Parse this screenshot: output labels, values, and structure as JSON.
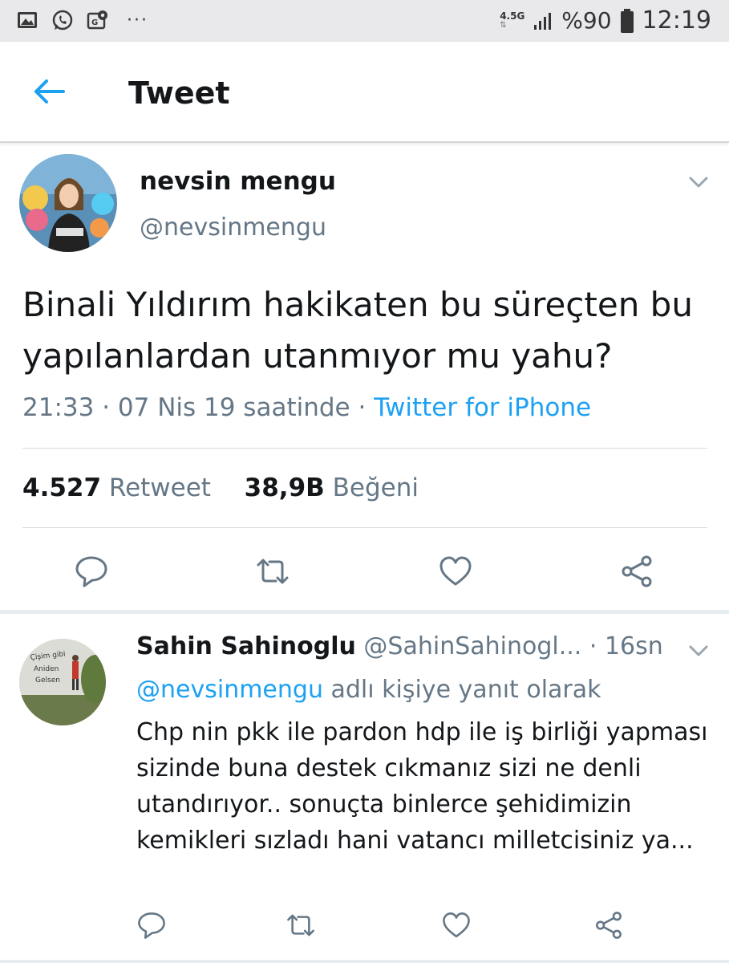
{
  "status_bar": {
    "network": "4.5G",
    "battery": "%90",
    "time": "12:19",
    "left_icons": [
      "image-icon",
      "whatsapp-icon",
      "gallery-map-icon"
    ],
    "more": "···"
  },
  "header": {
    "title": "Tweet",
    "accent": "#1da1f2"
  },
  "tweet": {
    "author_name": "nevsin mengu",
    "author_handle": "@nevsinmengu",
    "text": "Binali Yıldırım hakikaten bu süreçten bu yapılanlardan utanmıyor mu yahu?",
    "timestamp": "21:33 · 07 Nis 19 saatinde · ",
    "source": "Twitter for iPhone",
    "retweet_count": "4.527",
    "retweet_label": "Retweet",
    "like_count": "38,9B",
    "like_label": "Beğeni"
  },
  "reply": {
    "author_name": "Sahin Sahinoglu",
    "author_handle": "@SahinSahinogl...",
    "time": "· 16sn",
    "reply_to_mention": "@nevsinmengu",
    "reply_to_suffix": " adlı kişiye yanıt olarak",
    "text": "Chp nin pkk ile pardon hdp ile iş birliği yapması sizinde buna destek cıkmanız sizi ne denli utandırıyor..  sonuçta binlerce şehidimizin kemikleri sızladı hani vatancı milletcisiniz ya...",
    "avatar_graffiti": "Çişim gibi Aniden Gelsen"
  },
  "colors": {
    "link": "#1da1f2",
    "secondary_text": "#657786",
    "primary_text": "#14171a"
  }
}
